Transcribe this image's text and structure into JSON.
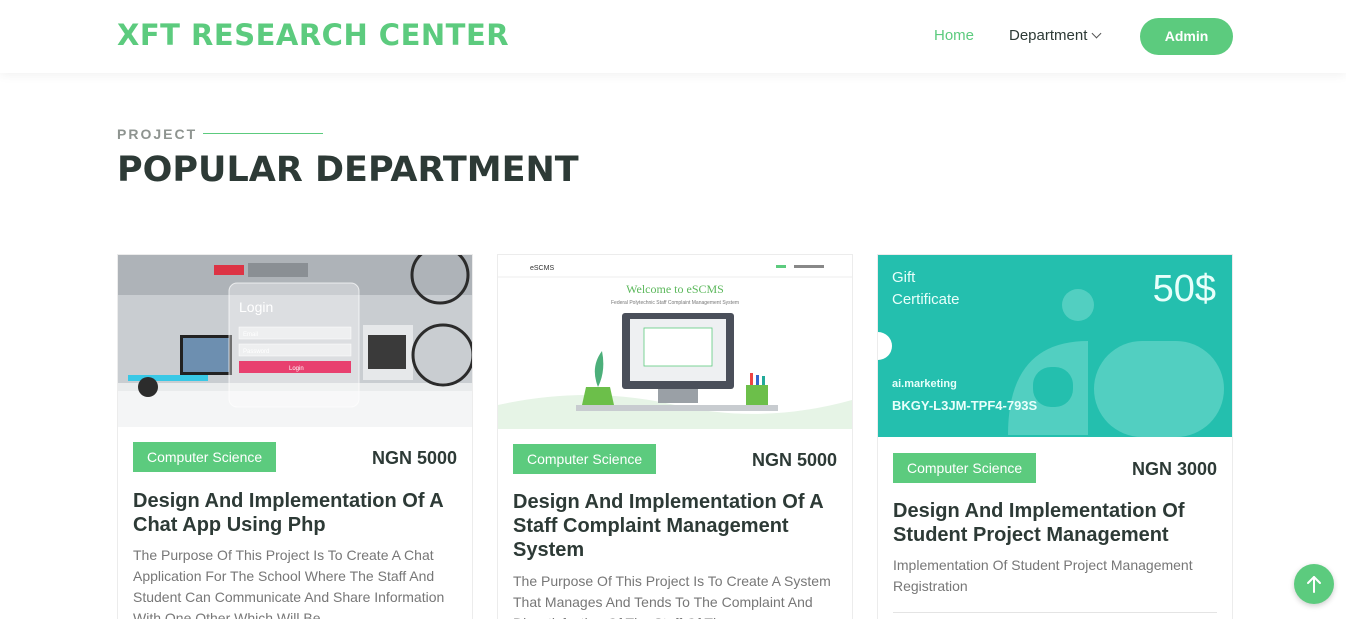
{
  "header": {
    "logo": "XFT RESEARCH CENTER",
    "nav": {
      "home": "Home",
      "department": "Department"
    },
    "admin_button": "Admin"
  },
  "section": {
    "tag": "PROJECT",
    "title": "POPULAR DEPARTMENT"
  },
  "cards": [
    {
      "category": "Computer Science",
      "price": "NGN 5000",
      "title": "Design And Implementation Of A Chat App Using Php",
      "description": "The Purpose Of This Project Is To Create A Chat Application For The School Where The Staff And Student Can Communicate And Share Information With One Other Which Will Be",
      "thumb": {
        "login_title": "Login",
        "email": "Email",
        "password": "Password",
        "login_button": "Login"
      }
    },
    {
      "category": "Computer Science",
      "price": "NGN 5000",
      "title": "Design And Implementation Of A Staff Complaint Management System",
      "description": "The Purpose Of This Project Is To Create A System That Manages And Tends To The Complaint And Dissatisfaction Of The Staff Of The",
      "thumb": {
        "brand": "eSCMS",
        "welcome": "Welcome to eSCMS",
        "subtitle": "Federal Polytechnic Staff Complaint Management System"
      }
    },
    {
      "category": "Computer Science",
      "price": "NGN 3000",
      "title": "Design And Implementation Of Student Project Management",
      "description": "Implementation Of Student Project Management Registration",
      "thumb": {
        "label": "Gift Certificate",
        "amount": "50$",
        "company": "ai.marketing",
        "code": "BKGY-L3JM-TPF4-793S"
      }
    }
  ],
  "colors": {
    "accent": "#5ccb7e",
    "teal": "#24bfae",
    "heading": "#2d3a36"
  },
  "icons": {
    "scroll_top": "arrow-up-icon",
    "dropdown": "chevron-down-icon"
  }
}
